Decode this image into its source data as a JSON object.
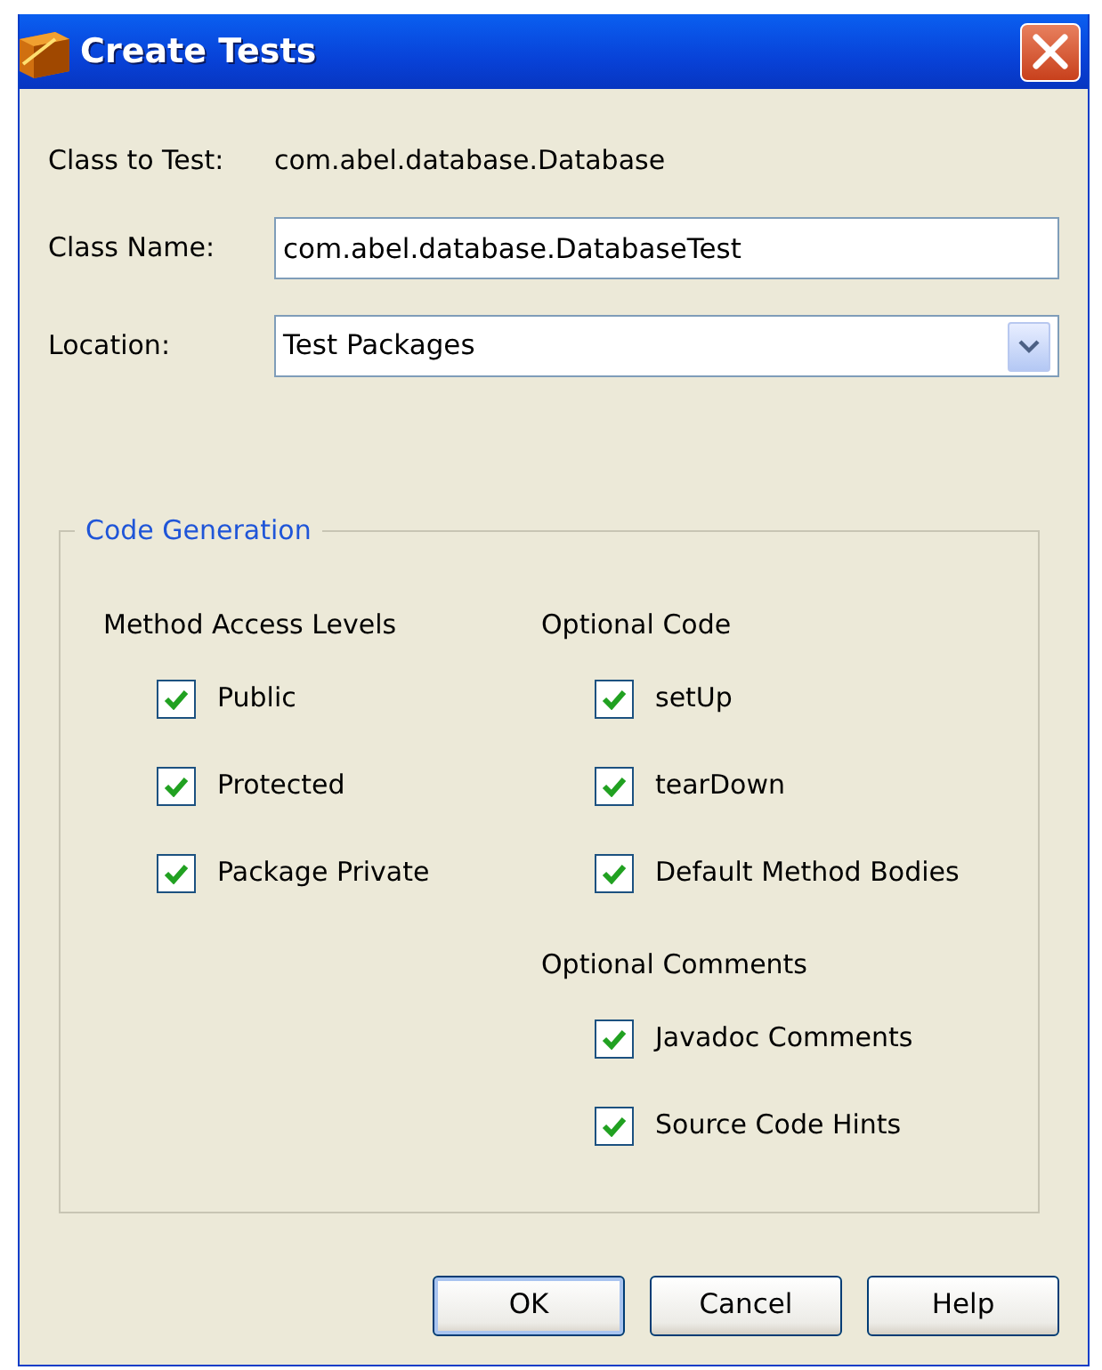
{
  "window": {
    "title": "Create Tests"
  },
  "class_to_test": {
    "label": "Class to Test:",
    "value": "com.abel.database.Database"
  },
  "class_name": {
    "label": "Class Name:",
    "value": "com.abel.database.DatabaseTest"
  },
  "location": {
    "label": "Location:",
    "value": "Test Packages"
  },
  "code_generation": {
    "title": "Code Generation",
    "method_access_levels": {
      "heading": "Method Access Levels",
      "options": [
        {
          "label": "Public",
          "checked": true
        },
        {
          "label": "Protected",
          "checked": true
        },
        {
          "label": "Package Private",
          "checked": true
        }
      ]
    },
    "optional_code": {
      "heading": "Optional Code",
      "options": [
        {
          "label": "setUp",
          "checked": true
        },
        {
          "label": "tearDown",
          "checked": true
        },
        {
          "label": "Default Method Bodies",
          "checked": true
        }
      ]
    },
    "optional_comments": {
      "heading": "Optional Comments",
      "options": [
        {
          "label": "Javadoc Comments",
          "checked": true
        },
        {
          "label": "Source Code Hints",
          "checked": true
        }
      ]
    }
  },
  "buttons": [
    {
      "label": "OK",
      "default": true
    },
    {
      "label": "Cancel",
      "default": false
    },
    {
      "label": "Help",
      "default": false
    }
  ]
}
